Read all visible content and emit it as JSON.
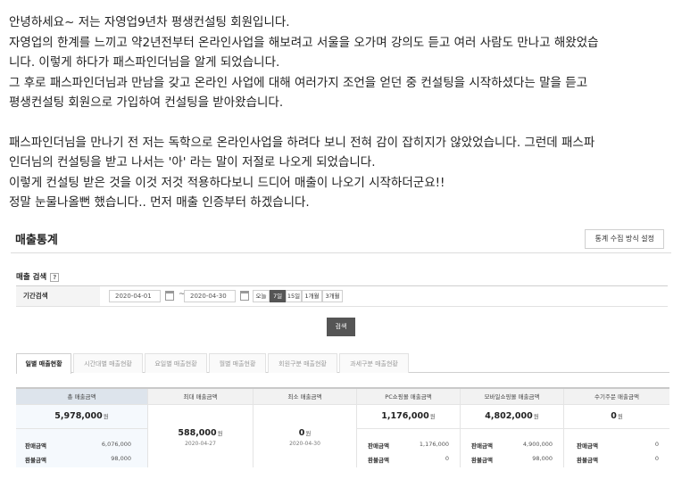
{
  "intro": {
    "lines": [
      "안녕하세요~ 저는 자영업9년차 평생컨설팅 회원입니다.",
      "자영업의 한계를 느끼고 약2년전부터 온라인사업을 해보려고 서울을 오가며 강의도 듣고 여러 사람도 만나고 해왔었습",
      "니다. 이렇게 하다가 패스파인더님을 알게 되었습니다.",
      "그 후로 패스파인더님과 만남을 갖고 온라인 사업에 대해 여러가지 조언을 얻던 중 컨설팅을 시작하셨다는 말을 듣고",
      "평생컨설팅 회원으로 가입하여 컨설팅을 받아왔습니다.",
      "패스파인더님을 만나기 전 저는 독학으로 온라인사업을 하려다 보니 전혀 감이 잡히지가 않았었습니다. 그런데 패스파",
      "인더님의 컨설팅을 받고 나서는 '아' 라는 말이 저절로 나오게 되었습니다.",
      "이렇게 컨설팅 받은 것을 이것 저것 적용하다보니 드디어 매출이 나오기 시작하더군요!!",
      "정말 눈물나올뻔 했습니다.. 먼저 매출 인증부터 하겠습니다."
    ]
  },
  "panel": {
    "title": "매출통계",
    "setting_button": "통계 수집 방식 설정",
    "search_label": "매출 검색",
    "help_icon": "?",
    "period_label": "기간검색",
    "date_from": "2020-04-01",
    "date_to": "2020-04-30",
    "tilde": "~",
    "quick_buttons": [
      "오늘",
      "7일",
      "15일",
      "1개월",
      "3개월"
    ],
    "quick_active": "7일",
    "search_button": "검색",
    "tabs": [
      "일별 매출현황",
      "시간대별 매출현황",
      "요일별 매출현황",
      "월별 매출현황",
      "회원구분 매출현황",
      "과세구분 매출현황"
    ],
    "stats": {
      "total": {
        "head": "총 매출금액",
        "value": "5,978,000",
        "unit": "원",
        "sales_label": "판매금액",
        "sales": "6,076,000",
        "refund_label": "환불금액",
        "refund": "98,000"
      },
      "max": {
        "head": "최대 매출금액",
        "value": "588,000",
        "unit": "원",
        "date": "2020-04-27"
      },
      "min": {
        "head": "최소 매출금액",
        "value": "0",
        "unit": "원",
        "date": "2020-04-30"
      },
      "pc": {
        "head": "PC쇼핑몰 매출금액",
        "value": "1,176,000",
        "unit": "원",
        "sales_label": "판매금액",
        "sales": "1,176,000",
        "refund_label": "환불금액",
        "refund": "0"
      },
      "mobile": {
        "head": "모바일쇼핑몰 매출금액",
        "value": "4,802,000",
        "unit": "원",
        "sales_label": "판매금액",
        "sales": "4,900,000",
        "refund_label": "환불금액",
        "refund": "98,000"
      },
      "manual": {
        "head": "수기주문 매출금액",
        "value": "0",
        "unit": "원",
        "sales_label": "판매금액",
        "sales": "0",
        "refund_label": "환불금액",
        "refund": "0"
      }
    }
  }
}
